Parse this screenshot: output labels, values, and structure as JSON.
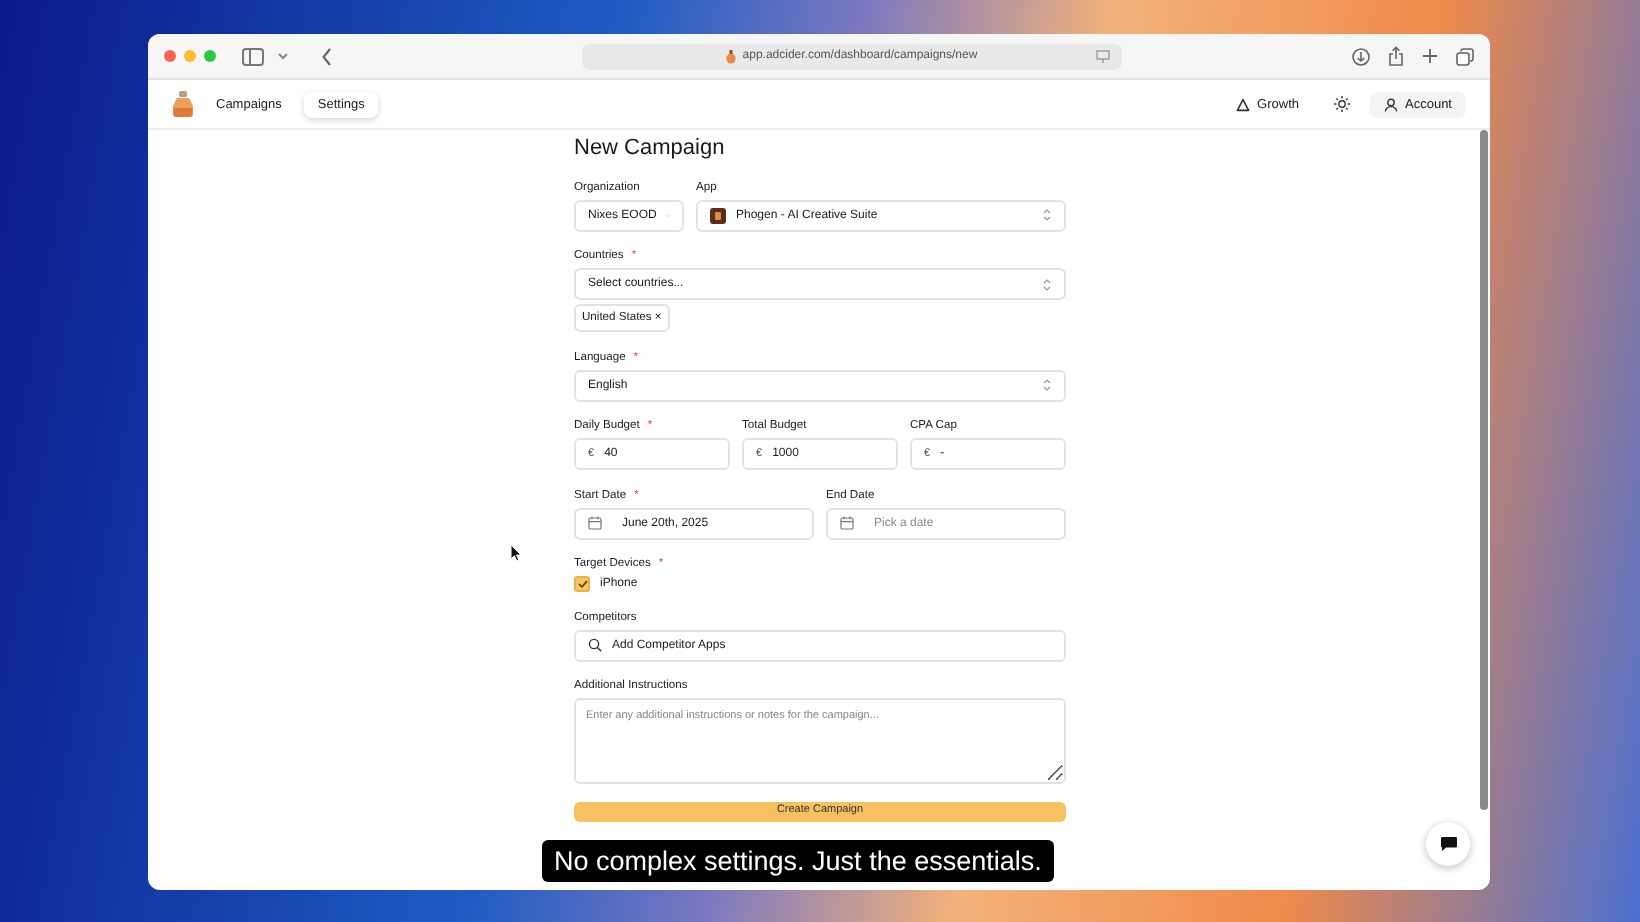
{
  "browser": {
    "url": "app.adcider.com/dashboard/campaigns/new"
  },
  "nav": {
    "items": [
      {
        "label": "Campaigns",
        "selected": false
      },
      {
        "label": "Settings",
        "selected": true
      }
    ],
    "growth": "Growth",
    "account": "Account"
  },
  "form": {
    "title": "New Campaign",
    "organization": {
      "label": "Organization",
      "value": "Nixes EOOD"
    },
    "app": {
      "label": "App",
      "value": "Phogen - AI Creative Suite"
    },
    "countries": {
      "label": "Countries",
      "mark": "*",
      "placeholder": "Select countries...",
      "tags": [
        {
          "label": "United States",
          "remove": "×"
        }
      ]
    },
    "language": {
      "label": "Language",
      "mark": "*",
      "value": "English"
    },
    "budgets": [
      {
        "label": "Daily Budget",
        "mark": "*",
        "currency": "€",
        "value": "40"
      },
      {
        "label": "Total Budget",
        "currency": "€",
        "value": "1000"
      },
      {
        "label": "CPA Cap",
        "currency": "€",
        "value": "-"
      }
    ],
    "dates": [
      {
        "label": "Start Date",
        "mark": "*",
        "value": "June 20th, 2025"
      },
      {
        "label": "End Date",
        "placeholder": "Pick a date"
      }
    ],
    "devices": {
      "label": "Target Devices",
      "mark": "*",
      "options": [
        {
          "label": "iPhone",
          "checked": true
        }
      ]
    },
    "competitors": {
      "label": "Competitors",
      "placeholder": "Add Competitor Apps"
    },
    "instructions": {
      "label": "Additional Instructions",
      "placeholder": "Enter any additional instructions or notes for the campaign..."
    },
    "submit": "Create Campaign"
  },
  "caption": "No complex settings. Just the essentials."
}
